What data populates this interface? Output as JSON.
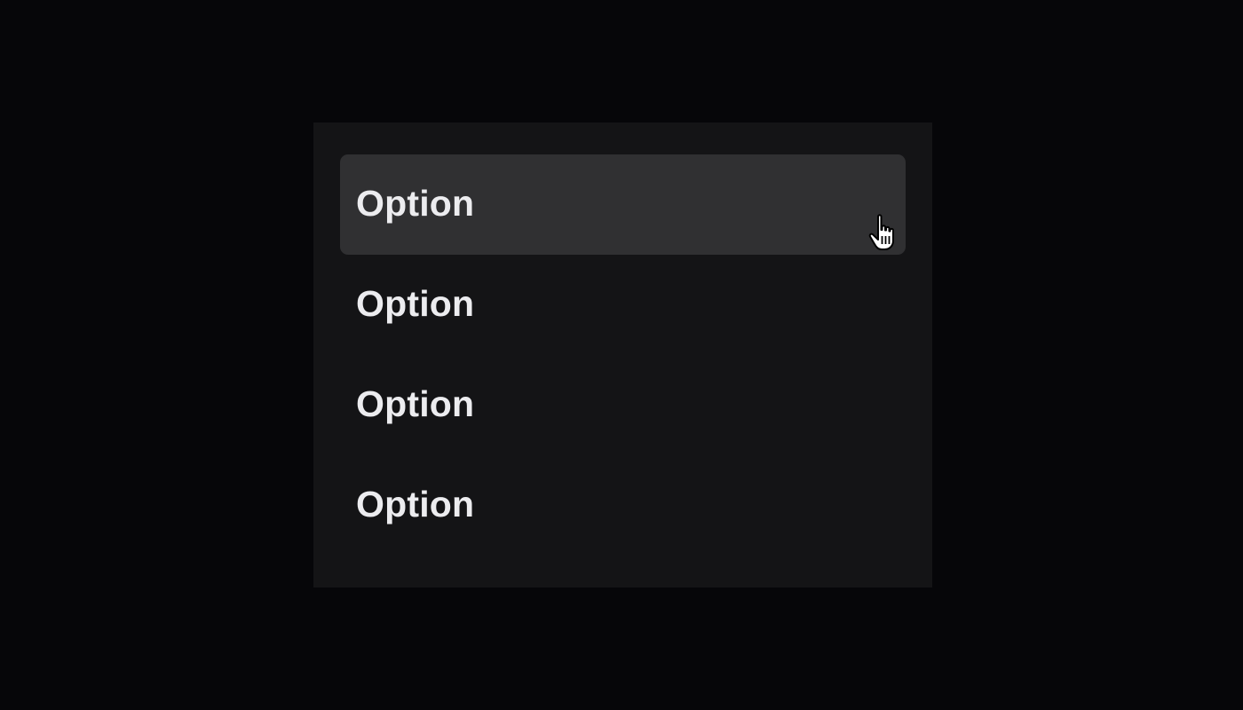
{
  "menu": {
    "items": [
      {
        "label": "Option",
        "state": "hovered"
      },
      {
        "label": "Option",
        "state": "default"
      },
      {
        "label": "Option",
        "state": "default"
      },
      {
        "label": "Option",
        "state": "default"
      }
    ]
  },
  "cursor": {
    "icon": "hand-pointer-icon"
  },
  "colors": {
    "background": "#060609",
    "panel": "#141416",
    "hover": "#303032",
    "text": "#ececef"
  }
}
